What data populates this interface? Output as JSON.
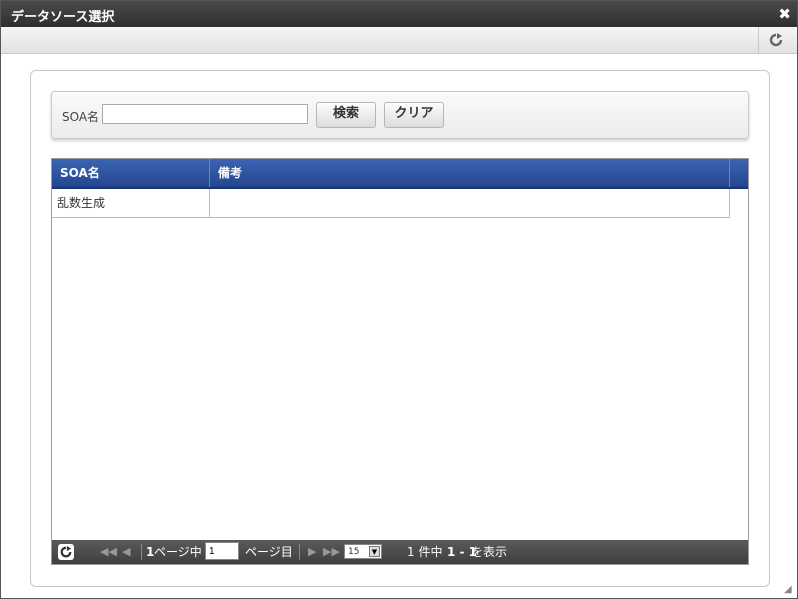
{
  "window": {
    "title": "データソース選択",
    "close_glyph": "✖"
  },
  "toolbar": {
    "refresh_icon": "refresh-icon"
  },
  "search": {
    "label": "SOA名",
    "input_value": "",
    "search_button": "検索",
    "clear_button": "クリア"
  },
  "grid": {
    "columns": [
      "SOA名",
      "備考"
    ],
    "rows": [
      {
        "soa_name": "乱数生成",
        "note": ""
      }
    ],
    "header_color": "#2f54a4"
  },
  "pager": {
    "current_page_prefix": "1",
    "page_of_text": "ページ中",
    "page_input": "1",
    "page_suffix": "ページ目",
    "page_size": "15",
    "total_text": "1 件中",
    "range_text": "1 - 1",
    "range_suffix": "を表示"
  }
}
